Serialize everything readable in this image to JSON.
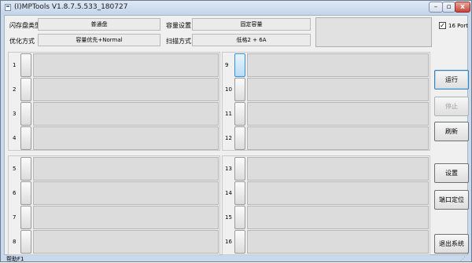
{
  "window": {
    "title": "(I)MPTools V1.8.7.5.533_180727",
    "minimize_glyph": "–",
    "maximize_glyph": "▫",
    "close_glyph": "x"
  },
  "info": {
    "flash_type_label": "闪存盘类型",
    "flash_type_value": "普通盘",
    "capacity_label": "容量设置",
    "capacity_value": "固定容量",
    "optimize_label": "优化方式",
    "optimize_value": "容量优先+Normal",
    "scan_label": "扫描方式",
    "scan_value": "低格2 + 6A"
  },
  "port16": {
    "label": "16 Port",
    "checked": true,
    "check_glyph": "✓"
  },
  "ports_left": [
    "1",
    "2",
    "3",
    "4",
    "5",
    "6",
    "7",
    "8"
  ],
  "ports_right": [
    "9",
    "10",
    "11",
    "12",
    "13",
    "14",
    "15",
    "16"
  ],
  "buttons": {
    "run": "运行",
    "stop": "停止",
    "refresh": "刷新",
    "settings": "设置",
    "port_locate": "端口定位",
    "exit": "退出系统"
  },
  "status": {
    "help": "帮助F1",
    "grip": "⋰"
  }
}
